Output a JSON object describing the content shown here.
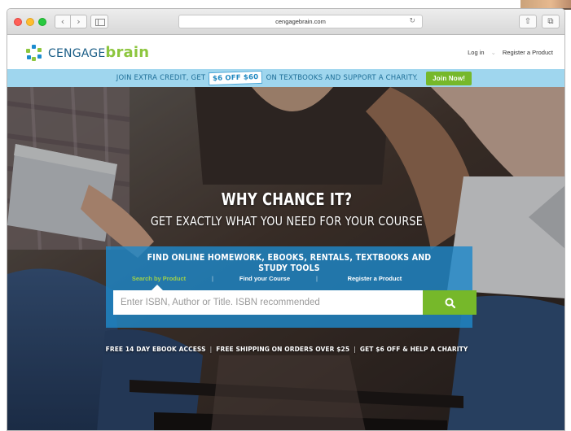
{
  "browser": {
    "url": "cengagebrain.com",
    "back_glyph": "‹",
    "forward_glyph": "›",
    "reload_glyph": "↻",
    "share_glyph": "⇧",
    "tabs_glyph": "⧉"
  },
  "header": {
    "logo_prefix": "CENGAGE",
    "logo_suffix": "brain",
    "login_label": "Log in",
    "register_label": "Register a Product"
  },
  "promo": {
    "text_before": "JOIN EXTRA CREDIT, GET",
    "badge": "$6 OFF $60",
    "text_after": "ON TEXTBOOKS AND SUPPORT A CHARITY.",
    "join_label": "Join Now!"
  },
  "hero": {
    "headline": "WHY CHANCE IT?",
    "subheadline": "GET EXACTLY WHAT YOU NEED FOR YOUR COURSE"
  },
  "search": {
    "title": "FIND ONLINE HOMEWORK, EBOOKS, RENTALS, TEXTBOOKS AND STUDY TOOLS",
    "tabs": [
      {
        "label": "Search by Product"
      },
      {
        "label": "Find your Course"
      },
      {
        "label": "Register a Product"
      }
    ],
    "tab_separator": "|",
    "placeholder": "Enter ISBN, Author or Title. ISBN recommended"
  },
  "benefits": {
    "item1": "FREE 14 DAY EBOOK ACCESS",
    "item2": "FREE SHIPPING ON ORDERS OVER $25",
    "item3": "GET $6 OFF & HELP A CHARITY",
    "separator": "|"
  },
  "colors": {
    "brand_blue": "#1b5e87",
    "brand_green": "#8dc63f",
    "promo_bg": "#9fd6ee",
    "search_panel": "#1e87c8",
    "button_green": "#76b82a"
  }
}
